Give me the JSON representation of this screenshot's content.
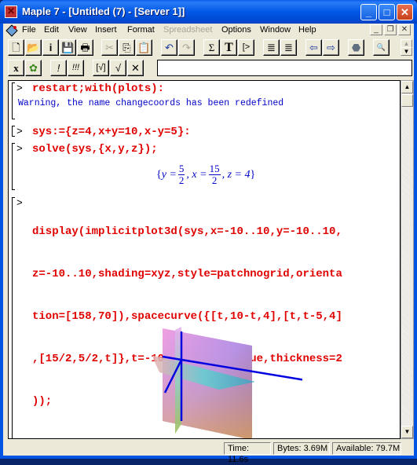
{
  "window": {
    "title": "Maple 7  - [Untitled (7) - [Server 1]]"
  },
  "menu": [
    {
      "label": "File",
      "enabled": true
    },
    {
      "label": "Edit",
      "enabled": true
    },
    {
      "label": "View",
      "enabled": true
    },
    {
      "label": "Insert",
      "enabled": true
    },
    {
      "label": "Format",
      "enabled": true
    },
    {
      "label": "Spreadsheet",
      "enabled": false
    },
    {
      "label": "Options",
      "enabled": true
    },
    {
      "label": "Window",
      "enabled": true
    },
    {
      "label": "Help",
      "enabled": true
    }
  ],
  "toolbar": {
    "icons": [
      "new-file-icon",
      "open-icon",
      "open-url-icon",
      "save-icon",
      "print-icon",
      "cut-icon",
      "copy-icon",
      "paste-icon",
      "undo-icon",
      "redo-icon",
      "math-sigma-icon",
      "text-T-icon",
      "prompt-icon",
      "outdent-icon",
      "indent-icon",
      "back-arrow-icon",
      "forward-arrow-icon",
      "stop-icon",
      "zoom-icon"
    ],
    "glyphs": {
      "new": "🗋",
      "open": "📂",
      "url": "i",
      "save": "💾",
      "print": "🖶",
      "cut": "✂",
      "copy": "⎘",
      "paste": "📋",
      "undo": "↶",
      "redo": "↷",
      "sigma": "Σ",
      "text": "T",
      "prompt": "[>",
      "outdent": "≣",
      "indent": "≣",
      "back": "⇦",
      "forward": "⇨",
      "stop": "⬣",
      "zoom": "🔍"
    }
  },
  "toolbar2": {
    "glyphs": {
      "x": "x",
      "maple": "✿",
      "exec": "!",
      "execall": "!!!",
      "check1": "[√]",
      "check2": "√",
      "cross": "✕"
    },
    "input_value": ""
  },
  "worksheet": {
    "prompt": ">",
    "cmd1": "restart;with(plots):",
    "warning": "Warning, the name changecoords has been redefined",
    "cmd2": "sys:={z=4,x+y=10,x-y=5}:",
    "cmd3": "solve(sys,{x,y,z});",
    "result": {
      "open": "{",
      "y_label": "y =",
      "y_num": "5",
      "y_den": "2",
      "x_label": ", x =",
      "x_num": "15",
      "x_den": "2",
      "z_part": ", z = 4",
      "close": "}"
    },
    "cmd4_lines": [
      "display(implicitplot3d(sys,x=-10..10,y=-10..10,",
      "z=-10..10,shading=xyz,style=patchnogrid,orienta",
      "tion=[158,70]),spacecurve({[t,10-t,4],[t,t-5,4]",
      ",[15/2,5/2,t]},t=-10..10,color=blue,thickness=2",
      "));"
    ]
  },
  "status": {
    "time": "Time:  11.6s",
    "bytes": "Bytes: 3.69M",
    "available": "Available: 79.7M"
  },
  "colors": {
    "command": "#e00000",
    "output": "#0000c8",
    "titlebar": "#0054e3"
  }
}
